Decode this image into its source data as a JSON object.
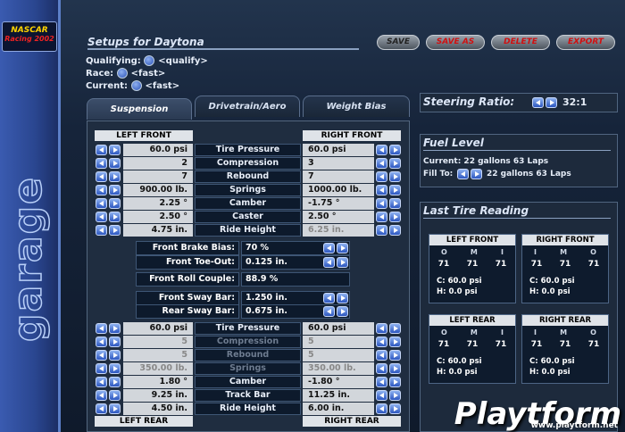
{
  "logo": {
    "line1": "NASCAR",
    "line2": "Racing 2002"
  },
  "sidebar_title": "garage",
  "header": {
    "title": "Setups for Daytona"
  },
  "session": [
    {
      "label": "Qualifying:",
      "value": "<qualify>"
    },
    {
      "label": "Race:",
      "value": "<fast>"
    },
    {
      "label": "Current:",
      "value": "<fast>"
    }
  ],
  "toolbar": {
    "save": "SAVE",
    "save_as": "SAVE AS",
    "delete": "DELETE",
    "export": "EXPORT"
  },
  "tabs": [
    "Suspension",
    "Drivetrain/Aero",
    "Weight Bias"
  ],
  "front": {
    "left_header": "LEFT FRONT",
    "right_header": "RIGHT FRONT",
    "rows": [
      {
        "label": "Tire Pressure",
        "left": "60.0 psi",
        "right": "60.0 psi"
      },
      {
        "label": "Compression",
        "left": "2",
        "right": "3"
      },
      {
        "label": "Rebound",
        "left": "7",
        "right": "7"
      },
      {
        "label": "Springs",
        "left": "900.00 lb.",
        "right": "1000.00 lb."
      },
      {
        "label": "Camber",
        "left": "2.25 °",
        "right": "-1.75 °"
      },
      {
        "label": "Caster",
        "left": "2.50 °",
        "right": "2.50 °"
      },
      {
        "label": "Ride Height",
        "left": "4.75 in.",
        "right": "6.25 in."
      }
    ]
  },
  "center": [
    {
      "label": "Front Brake Bias:",
      "value": "70 %"
    },
    {
      "label": "Front Toe-Out:",
      "value": "0.125 in."
    },
    {
      "label": "Front Roll Couple:",
      "value": "88.9 %"
    },
    {
      "label": "Front Sway Bar:",
      "value": "1.250 in."
    },
    {
      "label": "Rear Sway Bar:",
      "value": "0.675 in."
    }
  ],
  "rear": {
    "left_header": "LEFT REAR",
    "right_header": "RIGHT REAR",
    "rows": [
      {
        "label": "Tire Pressure",
        "left": "60.0 psi",
        "right": "60.0 psi"
      },
      {
        "label": "Compression",
        "left": "5",
        "right": "5"
      },
      {
        "label": "Rebound",
        "left": "5",
        "right": "5"
      },
      {
        "label": "Springs",
        "left": "350.00 lb.",
        "right": "350.00 lb."
      },
      {
        "label": "Camber",
        "left": "1.80 °",
        "right": "-1.80 °"
      },
      {
        "label": "Track Bar",
        "left": "9.25 in.",
        "right": "11.25 in."
      },
      {
        "label": "Ride Height",
        "left": "4.50 in.",
        "right": "6.00 in."
      }
    ]
  },
  "steering": {
    "label": "Steering Ratio:",
    "value": "32:1"
  },
  "fuel": {
    "title": "Fuel Level",
    "current": "Current: 22 gallons 63 Laps",
    "fill_label": "Fill To:",
    "fill_value": "22 gallons 63 Laps"
  },
  "tires": {
    "title": "Last Tire Reading",
    "lf": {
      "name": "LEFT FRONT",
      "h1": "O",
      "h2": "M",
      "h3": "I",
      "v1": "71",
      "v2": "71",
      "v3": "71",
      "c": "C: 60.0 psi",
      "hp": "H: 0.0 psi"
    },
    "rf": {
      "name": "RIGHT FRONT",
      "h1": "I",
      "h2": "M",
      "h3": "O",
      "v1": "71",
      "v2": "71",
      "v3": "71",
      "c": "C: 60.0 psi",
      "hp": "H: 0.0 psi"
    },
    "lr": {
      "name": "LEFT REAR",
      "h1": "O",
      "h2": "M",
      "h3": "I",
      "v1": "71",
      "v2": "71",
      "v3": "71",
      "c": "C: 60.0 psi",
      "hp": "H: 0.0 psi"
    },
    "rr": {
      "name": "RIGHT REAR",
      "h1": "I",
      "h2": "M",
      "h3": "O",
      "v1": "71",
      "v2": "71",
      "v3": "71",
      "c": "C: 60.0 psi",
      "hp": "H: 0.0 psi"
    }
  },
  "watermark": {
    "brand": "Playtform",
    "url": "www.playtform.net"
  }
}
